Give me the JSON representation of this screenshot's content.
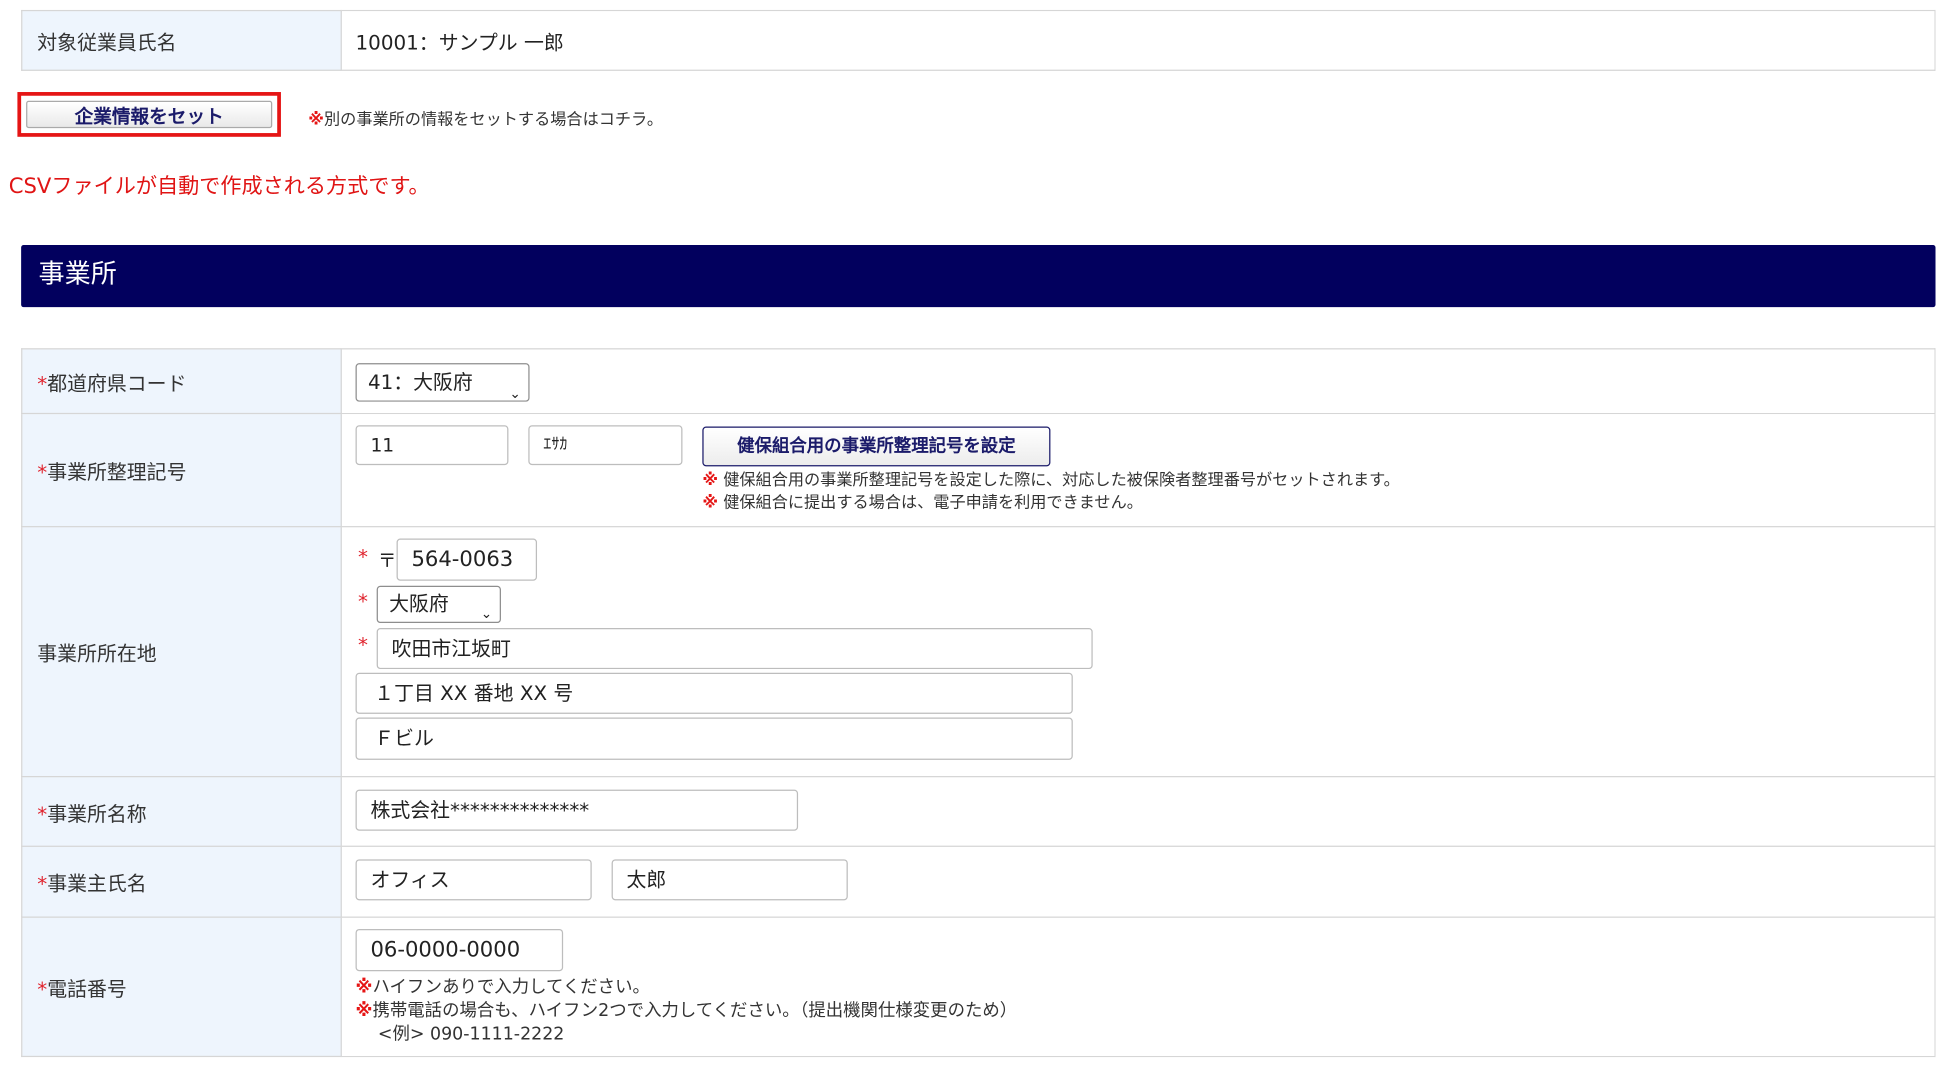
{
  "employee": {
    "label": "対象従業員氏名",
    "value": "10001：サンプル 一郎"
  },
  "set_company_button": "企業情報をセット",
  "set_company_note_mark": "※",
  "set_company_note": "別の事業所の情報をセットする場合はコチラ。",
  "csv_note": "CSVファイルが自動で作成される方式です。",
  "section_title": "事業所",
  "required_mark": "*",
  "rows": {
    "prefecture_code": {
      "label": "都道府県コード",
      "value": "41：大阪府"
    },
    "office_code": {
      "label": "事業所整理記号",
      "code1": "11",
      "code2": "ｴｻｶ",
      "button": "健保組合用の事業所整理記号を設定",
      "note_mark": "※",
      "note1": "健保組合用の事業所整理記号を設定した際に、対応した被保険者整理番号がセットされます。",
      "note2": "健保組合に提出する場合は、電子申請を利用できません。"
    },
    "address": {
      "label": "事業所所在地",
      "postal_mark": "〒",
      "postal": "564-0063",
      "prefecture": "大阪府",
      "city": "吹田市江坂町",
      "line1": "１丁目 XX 番地 XX 号",
      "line2": "Ｆビル"
    },
    "office_name": {
      "label": "事業所名称",
      "value": "株式会社**************"
    },
    "owner_name": {
      "label": "事業主氏名",
      "last": "オフィス",
      "first": "太郎"
    },
    "phone": {
      "label": "電話番号",
      "value": "06-0000-0000",
      "note_mark": "※",
      "note1": "ハイフンありで入力してください。",
      "note2": "携帯電話の場合も、ハイフン2つで入力してください。（提出機関仕様変更のため）",
      "example": "<例> 090-1111-2222"
    }
  },
  "colors": {
    "header_bg": "#02005e",
    "label_bg": "#eef5fd",
    "required": "#e0242e",
    "highlight_border": "#e51515"
  }
}
